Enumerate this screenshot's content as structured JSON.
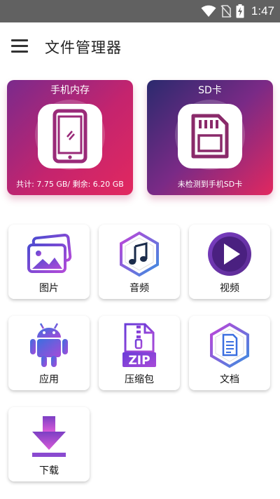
{
  "status_bar": {
    "time": "1:47",
    "icons": [
      "wifi-icon",
      "no-sim-icon",
      "battery-charging-icon"
    ]
  },
  "app_bar": {
    "title": "文件管理器",
    "menu_icon": "menu-icon"
  },
  "storage": {
    "internal": {
      "title": "手机内存",
      "info": "共计: 7.75 GB/ 剩余: 6.20 GB",
      "icon": "phone-icon"
    },
    "sd": {
      "title": "SD卡",
      "info": "未检测到手机SD卡",
      "icon": "sd-card-icon"
    }
  },
  "categories": [
    {
      "label": "图片",
      "icon": "image-icon"
    },
    {
      "label": "音频",
      "icon": "music-icon"
    },
    {
      "label": "视频",
      "icon": "video-play-icon"
    },
    {
      "label": "应用",
      "icon": "android-icon"
    },
    {
      "label": "压缩包",
      "icon": "zip-icon"
    },
    {
      "label": "文档",
      "icon": "document-icon"
    },
    {
      "label": "下载",
      "icon": "download-icon"
    }
  ],
  "colors": {
    "accent_purple": "#7b3fc4",
    "accent_pink": "#e2285f",
    "status_bar": "#616161"
  }
}
